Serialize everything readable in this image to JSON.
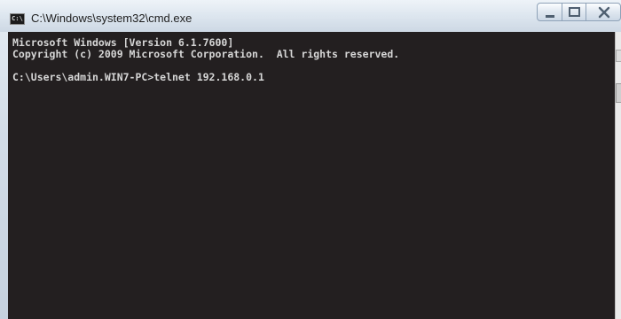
{
  "window": {
    "title": "C:\\Windows\\system32\\cmd.exe",
    "icon_label": "C:\\"
  },
  "console": {
    "lines": [
      "Microsoft Windows [Version 6.1.7600]",
      "Copyright (c) 2009 Microsoft Corporation.  All rights reserved.",
      "",
      "C:\\Users\\admin.WIN7-PC>telnet 192.168.0.1"
    ]
  },
  "icons": {
    "app": "cmd-icon",
    "minimize": "minimize-icon",
    "maximize": "maximize-icon",
    "close": "close-icon"
  },
  "colors": {
    "console_background": "#231f20",
    "console_text": "#d6d6d6",
    "titlebar": "#dde6ef"
  }
}
